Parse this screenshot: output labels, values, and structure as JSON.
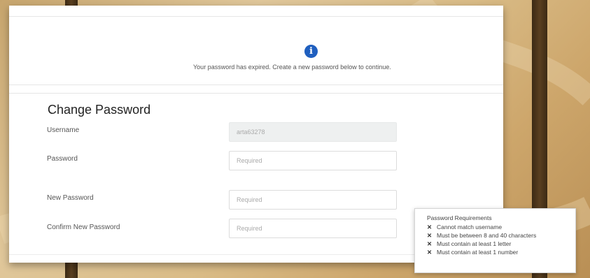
{
  "banner": {
    "icon": "info-icon",
    "icon_glyph": "i",
    "message": "Your password has expired. Create a new password below to continue."
  },
  "form": {
    "title": "Change Password",
    "username": {
      "label": "Username",
      "value": "arta63278"
    },
    "password": {
      "label": "Password",
      "placeholder": "Required"
    },
    "new_password": {
      "label": "New Password",
      "placeholder": "Required"
    },
    "confirm_password": {
      "label": "Confirm New Password",
      "placeholder": "Required"
    }
  },
  "requirements": {
    "title": "Password Requirements",
    "status_icon": "x-icon",
    "status_glyph": "✕",
    "items": [
      "Cannot match username",
      "Must be between 8 and 40 characters",
      "Must contain at least 1 letter",
      "Must contain at least 1 number"
    ]
  }
}
